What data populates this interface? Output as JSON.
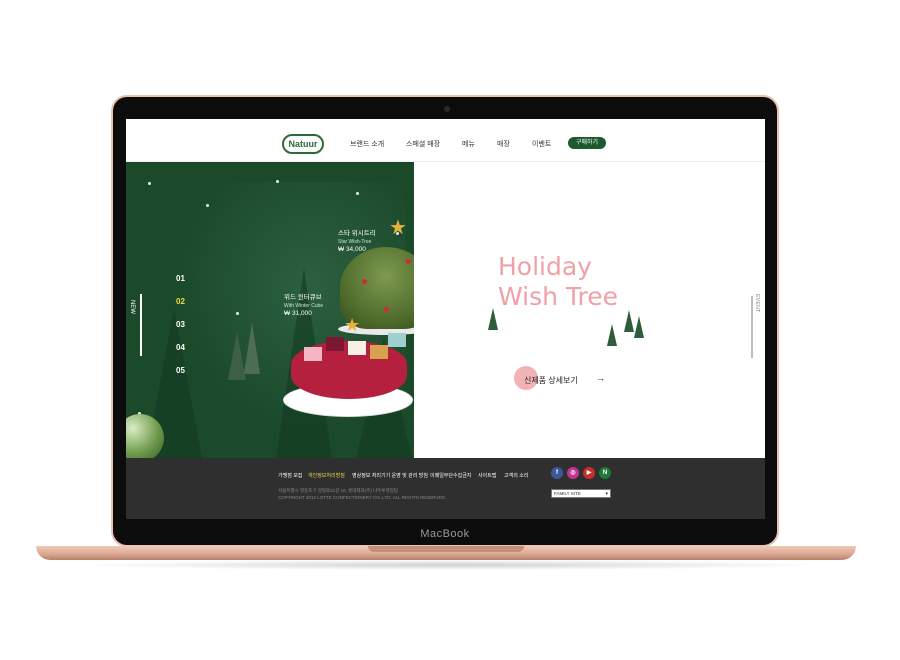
{
  "device": {
    "label": "MacBook"
  },
  "header": {
    "logo_text": "Natuur",
    "nav": [
      "브랜드 소개",
      "스페셜 매장",
      "메뉴",
      "매장",
      "이벤트"
    ],
    "buy_button": "구매하기"
  },
  "hero": {
    "side_label_left": "NEW",
    "side_label_right": "EVENT",
    "slide_numbers": [
      "01",
      "02",
      "03",
      "04",
      "05"
    ],
    "active_slide": "02",
    "products": [
      {
        "name": "스타 위시트리",
        "sub": "Star Wish-Tree",
        "price": "₩ 34,000"
      },
      {
        "name": "위드 윈터큐브",
        "sub": "With Winter Cube",
        "price": "₩ 31,000"
      }
    ],
    "headline_line1": "Holiday",
    "headline_line2": "Wish Tree",
    "detail_link": "신제품 상세보기",
    "detail_arrow": "→"
  },
  "footer": {
    "links": [
      "가맹점 모집",
      "개인정보처리방침",
      "영상정보 처리기기 운영 및 관리 방침",
      "이메일무단수집금지",
      "사이트맵",
      "고객의 소리"
    ],
    "highlight_link": "개인정보처리방침",
    "address": "서울특별시 영등포구 양평로21길 10, 롯데제과(주) 나뚜루영업팀",
    "copyright": "COPYRIGHT 2012 LOTTE CONFECTIONERY CO.,LTD. ALL RIGHTS RESERVED.",
    "family_site": "FAMILY SITE",
    "social": [
      {
        "name": "facebook-icon",
        "glyph": "f",
        "color": "#3b5998"
      },
      {
        "name": "instagram-icon",
        "glyph": "◎",
        "color": "#c1358f"
      },
      {
        "name": "youtube-icon",
        "glyph": "▶",
        "color": "#c4302b"
      },
      {
        "name": "natuur-n-icon",
        "glyph": "N",
        "color": "#1d7a3a"
      }
    ]
  },
  "colors": {
    "brand_green": "#1b4a2b",
    "accent_pink": "#f2a0a8",
    "footer_bg": "#2f2f2f",
    "highlight": "#f5d94a"
  }
}
